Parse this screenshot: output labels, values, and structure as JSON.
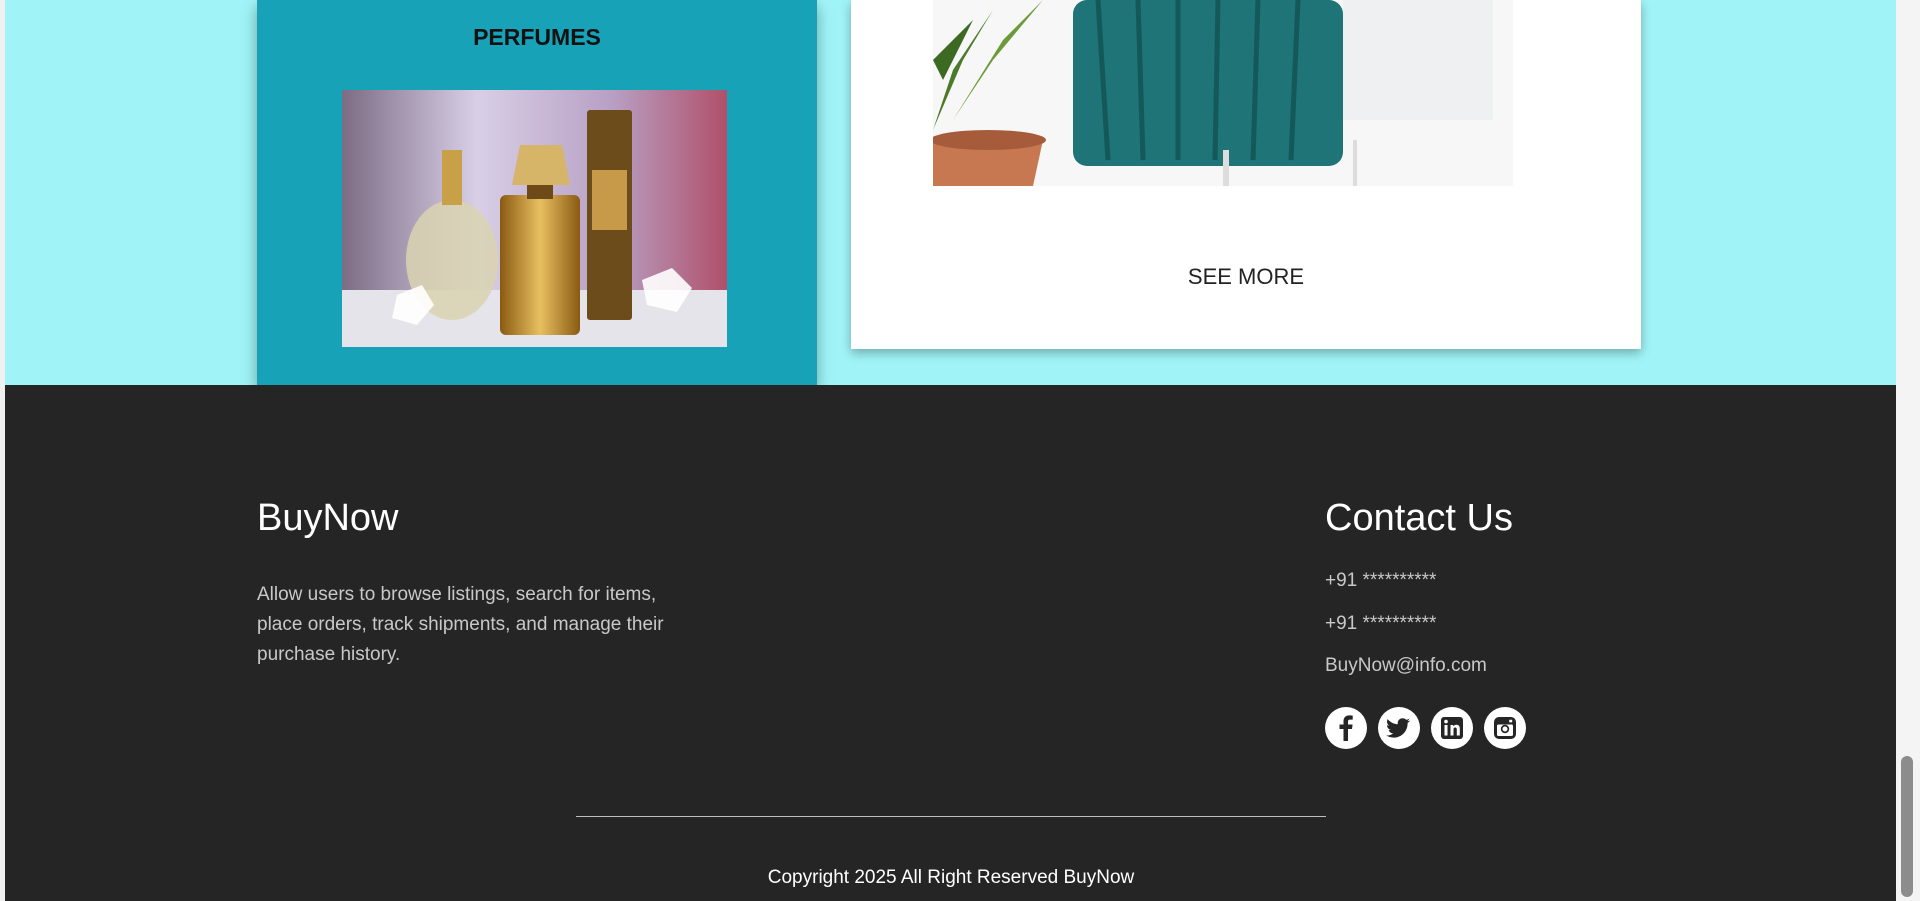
{
  "categories": {
    "perfume_title": "PERFUMES",
    "see_more_label": "SEE MORE"
  },
  "footer": {
    "brand": "BuyNow",
    "description": "Allow users to browse listings, search for items, place orders, track shipments, and manage their purchase history.",
    "contact_title": "Contact Us",
    "phone_1": "+91 **********",
    "phone_2": "+91 **********",
    "email": "BuyNow@info.com",
    "social_icons": [
      "facebook-icon",
      "twitter-icon",
      "linkedin-icon",
      "instagram-icon"
    ],
    "copyright": "Copyright 2025 All Right Reserved BuyNow"
  },
  "colors": {
    "section_bg": "#a0f4f7",
    "perfume_card_bg": "#17a2b8",
    "footer_bg": "#252525"
  }
}
